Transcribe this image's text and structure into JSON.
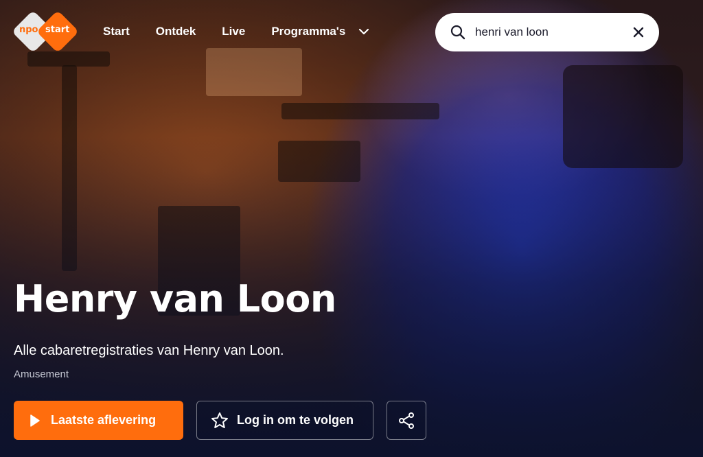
{
  "header": {
    "logo": {
      "part1": "npo",
      "part2": "start"
    },
    "nav": [
      {
        "label": "Start"
      },
      {
        "label": "Ontdek"
      },
      {
        "label": "Live"
      },
      {
        "label": "Programma's"
      }
    ],
    "search": {
      "value": "henri van loon",
      "placeholder": ""
    }
  },
  "program": {
    "title": "Henry van Loon",
    "description": "Alle cabaretregistraties van Henry van Loon.",
    "genre": "Amusement"
  },
  "actions": {
    "play_label": "Laatste aflevering",
    "follow_label": "Log in om te volgen"
  },
  "colors": {
    "accent": "#ff6d0d",
    "background": "#0d1530"
  },
  "icons": {
    "search": "search-icon",
    "close": "close-icon",
    "chevron": "chevron-down-icon",
    "play": "play-icon",
    "star": "star-icon",
    "share": "share-icon"
  }
}
